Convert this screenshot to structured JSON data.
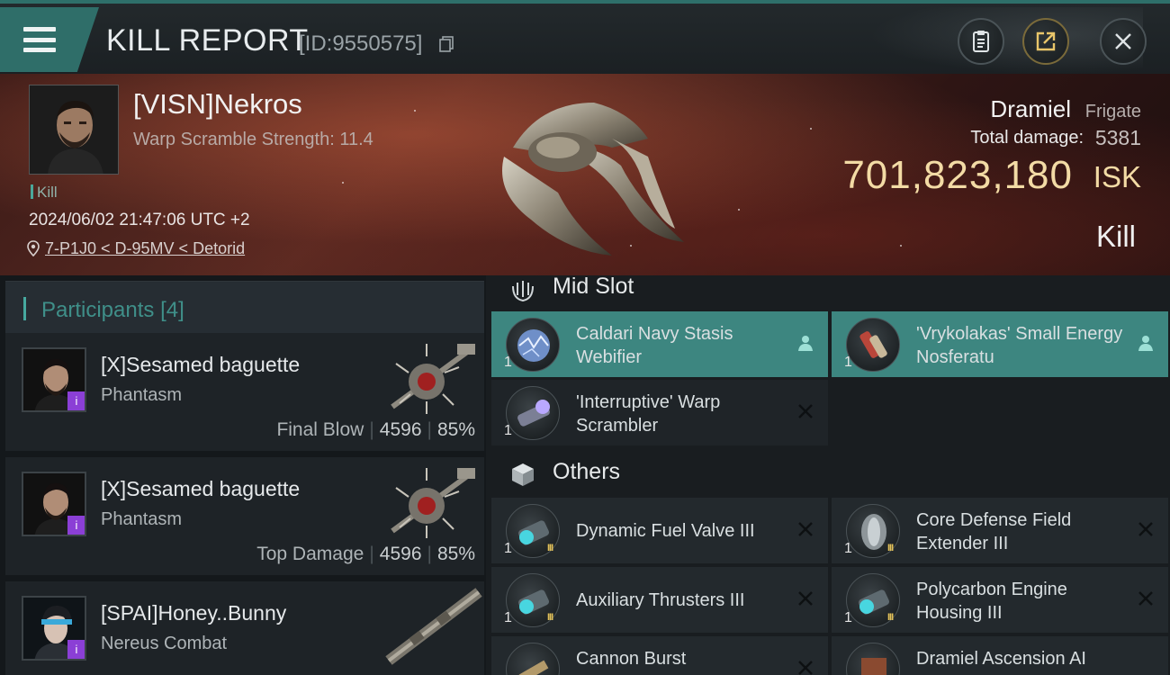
{
  "header": {
    "title": "KILL REPORT",
    "report_id": "[ID:9550575]"
  },
  "victim": {
    "name": "[VISN]Nekros",
    "scramble": "Warp Scramble Strength: 11.4",
    "kill_tag": "Kill",
    "datetime": "2024/06/02 21:47:06 UTC +2",
    "location": "7-P1J0 < D-95MV < Detorid"
  },
  "summary": {
    "ship_name": "Dramiel",
    "ship_class": "Frigate",
    "total_damage_label": "Total damage:",
    "total_damage": "5381",
    "isk_value": "701,823,180",
    "isk_unit": "ISK",
    "result": "Kill"
  },
  "participants": {
    "label": "Participants",
    "count": "[4]",
    "rows": [
      {
        "name": "[X]Sesamed baguette",
        "ship": "Phantasm",
        "tag": "Final Blow",
        "damage": "4596",
        "percent": "85%"
      },
      {
        "name": "[X]Sesamed baguette",
        "ship": "Phantasm",
        "tag": "Top Damage",
        "damage": "4596",
        "percent": "85%"
      },
      {
        "name": "[SPAI]Honey..Bunny",
        "ship": "Nereus Combat"
      }
    ],
    "badge_glyph": "i"
  },
  "fittings": {
    "mid_slot": {
      "label": "Mid Slot",
      "items": [
        {
          "name": "Caldari Navy Stasis Webifier",
          "qty": "1",
          "status": "person-icon"
        },
        {
          "name": "'Vrykolakas' Small Energy Nosferatu",
          "qty": "1",
          "status": "person-icon"
        },
        {
          "name": "'Interruptive' Warp Scrambler",
          "qty": "1",
          "status": "close-icon"
        }
      ]
    },
    "others": {
      "label": "Others",
      "items": [
        {
          "name": "Dynamic Fuel Valve III",
          "qty": "1",
          "tier": "III"
        },
        {
          "name": "Core Defense Field Extender III",
          "qty": "1",
          "tier": "III"
        },
        {
          "name": "Auxiliary Thrusters III",
          "qty": "1",
          "tier": "III"
        },
        {
          "name": "Polycarbon Engine Housing III",
          "qty": "1",
          "tier": "III"
        },
        {
          "name": "Cannon Burst"
        },
        {
          "name": "Dramiel Ascension AI"
        }
      ]
    }
  },
  "colors": {
    "accent": "#3d8680",
    "isk": "#f3dba5",
    "badge": "#8b3fd6"
  }
}
